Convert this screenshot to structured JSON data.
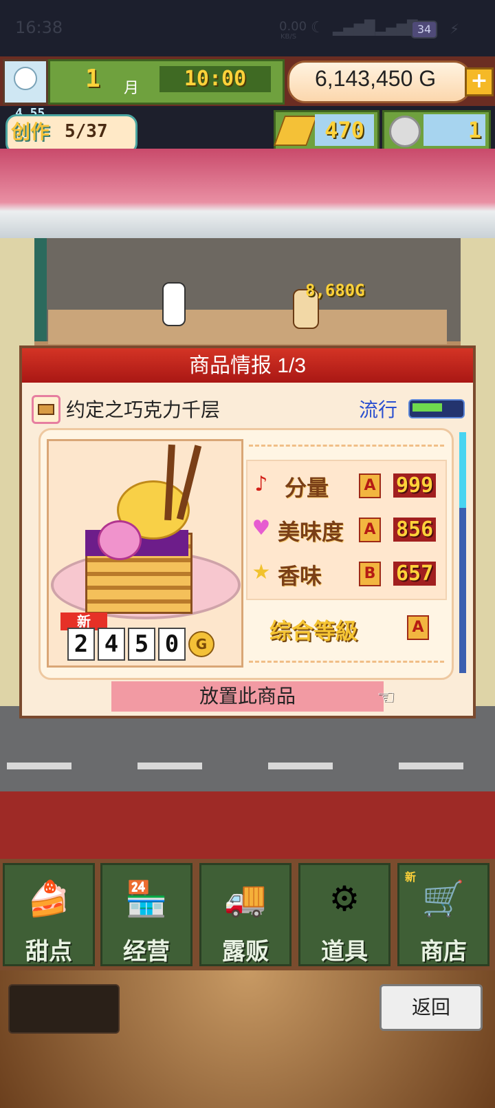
{
  "status_bar": {
    "time": "16:38",
    "net_speed": "0.00",
    "net_speed_unit": "KB/S",
    "battery": "34"
  },
  "header": {
    "month_number": "1",
    "month_unit": "月",
    "clock": "10:00",
    "gold": "6,143,450",
    "gold_unit": "G",
    "plus": "+"
  },
  "create": {
    "label": "创作",
    "count": "5/37",
    "level": "4 55"
  },
  "currencies": {
    "ingot": "470",
    "coin": "1"
  },
  "scene": {
    "float_text": "8,680G"
  },
  "dialog": {
    "title": "商品情报 1/3",
    "product_name": "约定之巧克力千层",
    "trend_label": "流行",
    "trend_level": 0.6,
    "new_tag": "新",
    "price_digits": [
      "2",
      "4",
      "5",
      "0"
    ],
    "price_unit": "G",
    "stats": [
      {
        "icon": "music-note-icon",
        "glyph": "♪",
        "label": "分量",
        "grade": "A",
        "value": "999"
      },
      {
        "icon": "heart-icon",
        "glyph": "♥",
        "label": "美味度",
        "grade": "A",
        "value": "856"
      },
      {
        "icon": "star-icon",
        "glyph": "★",
        "label": "香味",
        "grade": "B",
        "value": "657"
      }
    ],
    "overall_label": "综合等級",
    "overall_grade": "A",
    "place_button": "放置此商品"
  },
  "menu": {
    "items": [
      {
        "label": "甜点",
        "icon": "cake-icon",
        "glyph": "🍰",
        "new": ""
      },
      {
        "label": "经营",
        "icon": "shop-icon",
        "glyph": "🏪",
        "new": ""
      },
      {
        "label": "露贩",
        "icon": "truck-icon",
        "glyph": "🚚",
        "new": ""
      },
      {
        "label": "道具",
        "icon": "gear-bag-icon",
        "glyph": "⚙",
        "new": ""
      },
      {
        "label": "商店",
        "icon": "cart-icon",
        "glyph": "🛒",
        "new": "新"
      }
    ]
  },
  "footer": {
    "back_button": "返回"
  },
  "colors": {
    "title_red": "#c42a1e",
    "trend_blue": "#2a4fd0",
    "menu_green": "#3f5f36",
    "gold_text": "#ffd23a"
  }
}
